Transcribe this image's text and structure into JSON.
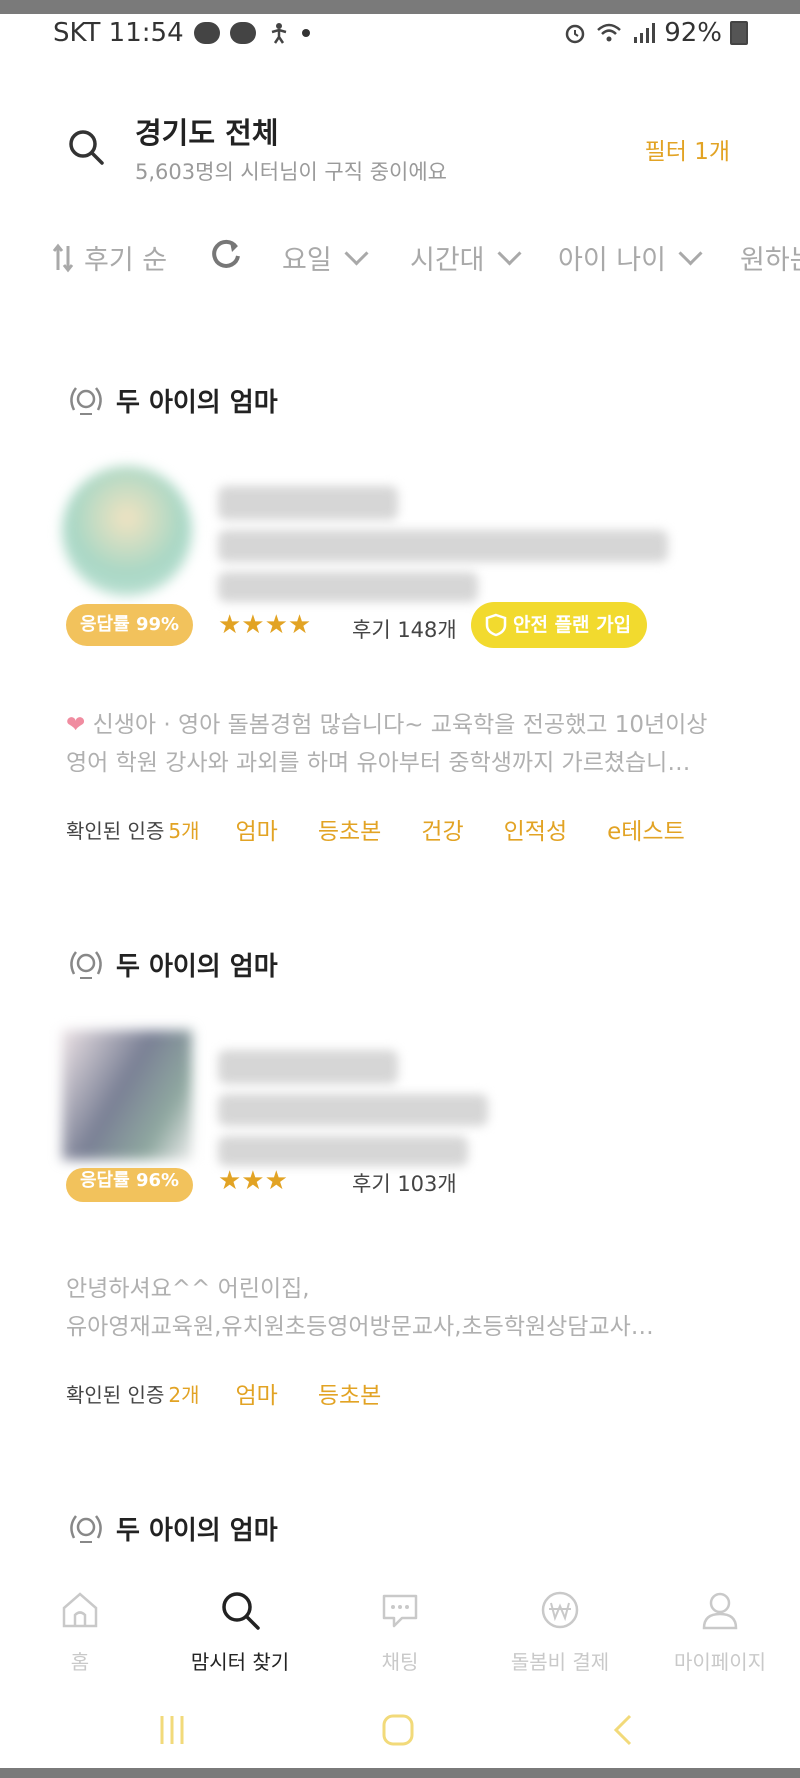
{
  "status_bar": {
    "carrier_time": "SKT 11:54",
    "battery": "92%"
  },
  "header": {
    "title": "경기도 전체",
    "subtitle": "5,603명의 시터님이 구직 중이에요",
    "filter_label": "필터 1개"
  },
  "filters": {
    "sort_label": "후기 순",
    "day_label": "요일",
    "time_label": "시간대",
    "age_label": "아이 나이",
    "more_label": "원하는"
  },
  "cards": [
    {
      "badge": "두 아이의 엄마",
      "response_rate": "응답률 99%",
      "stars": 4,
      "stars_text": "★★★★",
      "reviews": "후기 148개",
      "safety_badge": "안전 플랜 가입",
      "description_line1": "신생아 · 영아 돌봄경험 많습니다~ 교육학을 전공했고 10년이상",
      "description_line2": "영어 학원 강사와 과외를 하며 유아부터 중학생까지 가르쳤습니…",
      "certs_label": "확인된 인증",
      "certs_count": "5개",
      "cert_tags": [
        "엄마",
        "등초본",
        "건강",
        "인적성",
        "e테스트"
      ]
    },
    {
      "badge": "두 아이의 엄마",
      "response_rate": "응답률 96%",
      "stars": 3,
      "stars_text": "★★★",
      "reviews": "후기 103개",
      "description_line1": "안녕하셔요^^ 어린이집,",
      "description_line2": "유아영재교육원,유치원초등영어방문교사,초등학원상담교사…",
      "certs_label": "확인된 인증",
      "certs_count": "2개",
      "cert_tags": [
        "엄마",
        "등초본"
      ]
    },
    {
      "badge": "두 아이의 엄마"
    }
  ],
  "bottom_nav": [
    {
      "label": "홈",
      "icon": "home-icon"
    },
    {
      "label": "맘시터 찾기",
      "icon": "search-icon"
    },
    {
      "label": "채팅",
      "icon": "chat-icon"
    },
    {
      "label": "돌봄비 결제",
      "icon": "won-icon"
    },
    {
      "label": "마이페이지",
      "icon": "user-icon"
    }
  ],
  "colors": {
    "accent": "#e2a324",
    "safety": "#f2da2e",
    "response": "#f2c25c"
  }
}
